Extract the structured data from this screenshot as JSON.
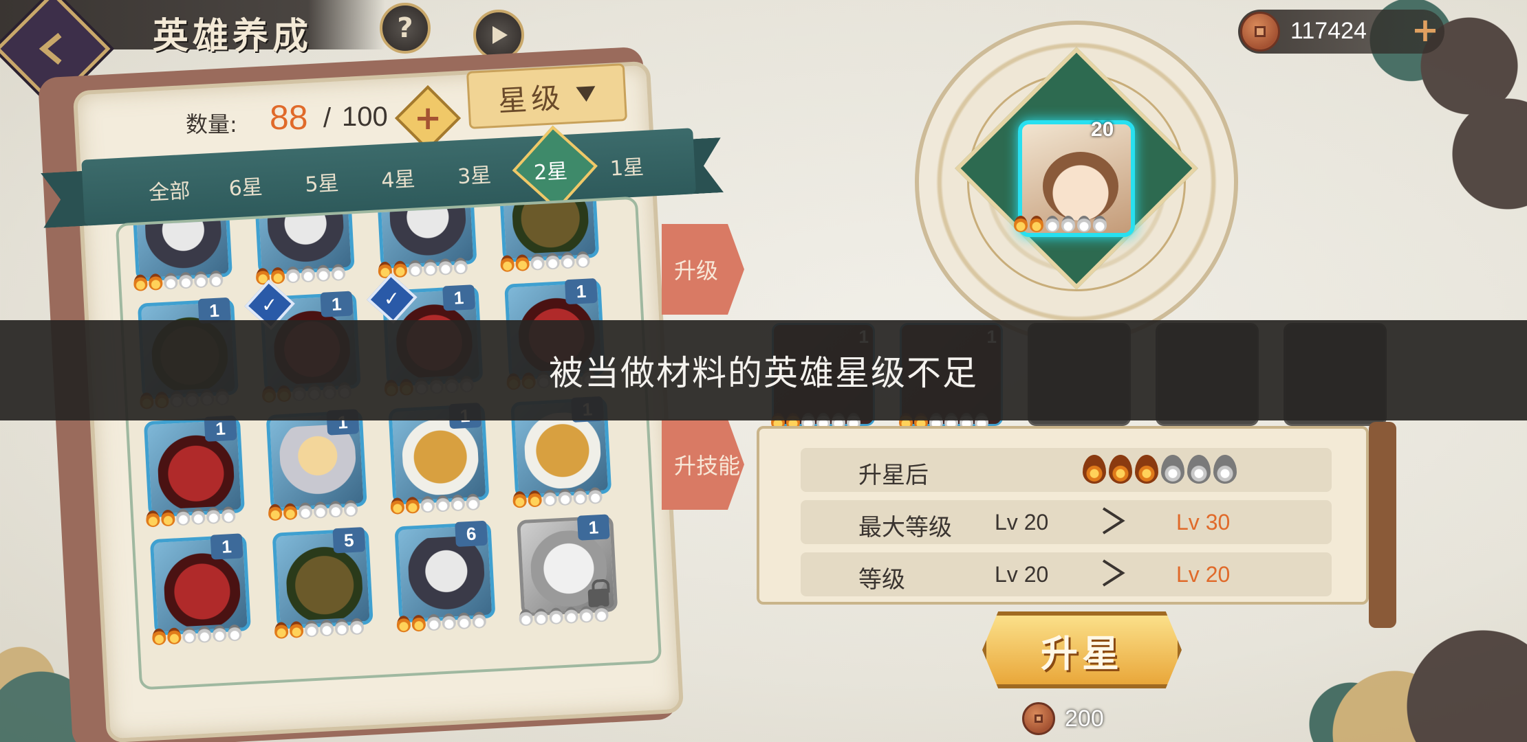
{
  "header": {
    "title": "英雄养成",
    "help_label": "?"
  },
  "currency": {
    "amount": "117424",
    "plus": "+"
  },
  "inventory": {
    "count_label": "数量:",
    "count_current": "88",
    "count_separator": "/",
    "count_max": "100",
    "add": "+"
  },
  "sort": {
    "label": "星级"
  },
  "filter_tabs": [
    {
      "label": "全部"
    },
    {
      "label": "6星"
    },
    {
      "label": "5星"
    },
    {
      "label": "4星"
    },
    {
      "label": "3星"
    },
    {
      "label": "2星"
    },
    {
      "label": "1星"
    }
  ],
  "active_filter": "2星",
  "side_tabs": {
    "upgrade": "升级",
    "skill": "升技能"
  },
  "hero_cards": [
    {
      "portrait": "mon-skull",
      "level": "",
      "stars_on": 2,
      "stars_total": 6
    },
    {
      "portrait": "mon-skull",
      "level": "",
      "stars_on": 2,
      "stars_total": 6
    },
    {
      "portrait": "mon-skull",
      "level": "",
      "stars_on": 2,
      "stars_total": 6
    },
    {
      "portrait": "mon-green",
      "level": "",
      "stars_on": 2,
      "stars_total": 6
    },
    {
      "portrait": "mon-green",
      "level": "1",
      "stars_on": 2,
      "stars_total": 6
    },
    {
      "portrait": "mon-red",
      "level": "1",
      "stars_on": 2,
      "stars_total": 6,
      "selected": true
    },
    {
      "portrait": "mon-red",
      "level": "1",
      "stars_on": 2,
      "stars_total": 6,
      "selected": true
    },
    {
      "portrait": "mon-red",
      "level": "1",
      "stars_on": 2,
      "stars_total": 6
    },
    {
      "portrait": "mon-red",
      "level": "1",
      "stars_on": 2,
      "stars_total": 6
    },
    {
      "portrait": "mon-knight",
      "level": "1",
      "stars_on": 2,
      "stars_total": 6
    },
    {
      "portrait": "mon-lion",
      "level": "1",
      "stars_on": 2,
      "stars_total": 6
    },
    {
      "portrait": "mon-lion",
      "level": "1",
      "stars_on": 2,
      "stars_total": 6
    },
    {
      "portrait": "mon-red",
      "level": "1",
      "stars_on": 2,
      "stars_total": 6
    },
    {
      "portrait": "mon-green",
      "level": "5",
      "stars_on": 2,
      "stars_total": 6
    },
    {
      "portrait": "mon-skull",
      "level": "6",
      "stars_on": 2,
      "stars_total": 6
    },
    {
      "portrait": "mon-ghost",
      "level": "1",
      "stars_on": 0,
      "stars_total": 6,
      "locked": true,
      "gray": true
    }
  ],
  "selected_hero": {
    "level": "20",
    "stars_on": 2,
    "stars_total": 6
  },
  "material_slots": [
    {
      "level": "1",
      "filled": true
    },
    {
      "level": "1",
      "filled": true
    },
    {
      "level": "",
      "filled": false
    },
    {
      "level": "",
      "filled": false
    },
    {
      "level": "",
      "filled": false
    }
  ],
  "upgrade_info": {
    "after_star_label": "升星后",
    "after_stars_on": 3,
    "after_stars_total": 6,
    "max_level_label": "最大等级",
    "max_level_from": "Lv 20",
    "max_level_to": "Lv 30",
    "level_label": "等级",
    "level_from": "Lv 20",
    "level_to": "Lv 20"
  },
  "upgrade_button": "升星",
  "cost": "200",
  "toast": "被当做材料的英雄星级不足",
  "colors": {
    "accent_orange": "#e06a2a",
    "ribbon_teal": "#2e5a5b",
    "selected_glow": "#28e0f0"
  }
}
